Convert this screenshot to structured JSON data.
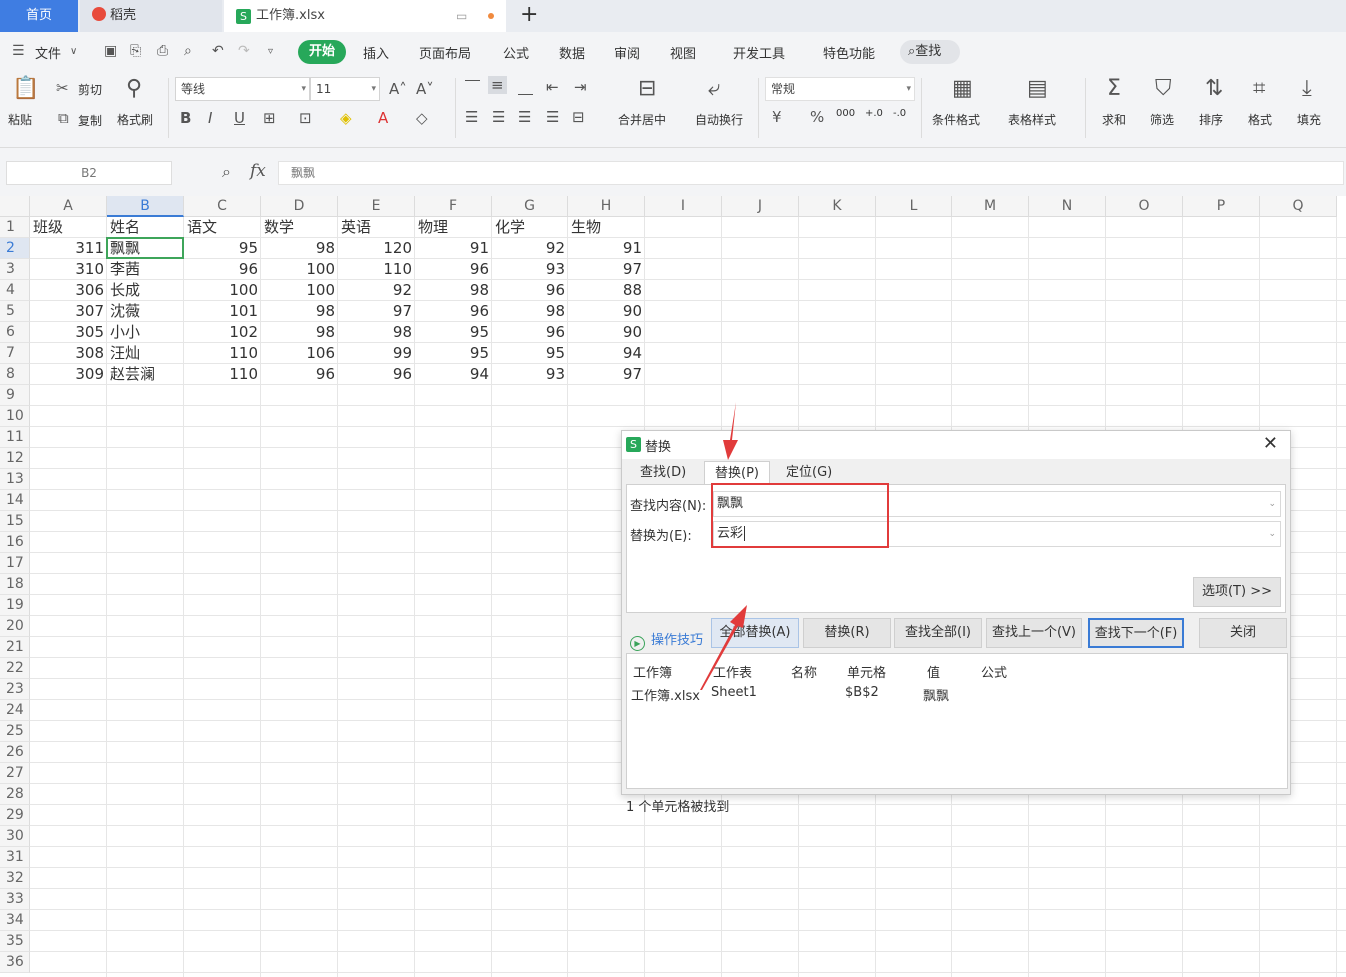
{
  "titlebar": {
    "home_tab": "首页",
    "app_tab": "稻壳",
    "file_tab": "工作簿.xlsx",
    "add_tab": "+"
  },
  "menubar": {
    "file_menu": "文件",
    "items": [
      "开始",
      "插入",
      "页面布局",
      "公式",
      "数据",
      "审阅",
      "视图",
      "开发工具",
      "特色功能"
    ],
    "search": "查找"
  },
  "ribbon": {
    "paste": "粘贴",
    "cut": "剪切",
    "copy": "复制",
    "format_painter": "格式刷",
    "font_name": "等线",
    "font_size": "11",
    "merge_center": "合并居中",
    "wrap_text": "自动换行",
    "number_format": "常规",
    "conditional_format": "条件格式",
    "table_style": "表格样式",
    "sum": "求和",
    "filter": "筛选",
    "sort": "排序",
    "format": "格式",
    "fill": "填充"
  },
  "formula_bar": {
    "name_box": "B2",
    "fx": "fx",
    "value": "飘飘"
  },
  "sheet": {
    "columns": [
      "A",
      "B",
      "C",
      "D",
      "E",
      "F",
      "G",
      "H",
      "I",
      "J",
      "K",
      "L",
      "M",
      "N",
      "O",
      "P",
      "Q"
    ],
    "rows": [
      "1",
      "2",
      "3",
      "4",
      "5",
      "6",
      "7",
      "8",
      "9",
      "10",
      "11",
      "12",
      "13",
      "14",
      "15",
      "16",
      "17",
      "18",
      "19",
      "20",
      "21",
      "22",
      "23",
      "24",
      "25",
      "26",
      "27",
      "28",
      "29",
      "30",
      "31",
      "32",
      "33",
      "34",
      "35",
      "36"
    ],
    "headers": [
      "班级",
      "姓名",
      "语文",
      "数学",
      "英语",
      "物理",
      "化学",
      "生物"
    ],
    "data": [
      [
        "311",
        "飘飘",
        "95",
        "98",
        "120",
        "91",
        "92",
        "91"
      ],
      [
        "310",
        "李茜",
        "96",
        "100",
        "110",
        "96",
        "93",
        "97"
      ],
      [
        "306",
        "长成",
        "100",
        "100",
        "92",
        "98",
        "96",
        "88"
      ],
      [
        "307",
        "沈薇",
        "101",
        "98",
        "97",
        "96",
        "98",
        "90"
      ],
      [
        "305",
        "小小",
        "102",
        "98",
        "98",
        "95",
        "96",
        "90"
      ],
      [
        "308",
        "汪灿",
        "110",
        "106",
        "99",
        "95",
        "95",
        "94"
      ],
      [
        "309",
        "赵芸澜",
        "110",
        "96",
        "96",
        "94",
        "93",
        "97"
      ]
    ]
  },
  "dialog": {
    "title": "替换",
    "tabs": [
      "查找(D)",
      "替换(P)",
      "定位(G)"
    ],
    "find_label": "查找内容(N):",
    "find_value": "飘飘",
    "replace_label": "替换为(E):",
    "replace_value": "云彩",
    "options_button": "选项(T) >>",
    "tips": "操作技巧",
    "buttons": {
      "replace_all": "全部替换(A)",
      "replace": "替换(R)",
      "find_all": "查找全部(I)",
      "find_prev": "查找上一个(V)",
      "find_next": "查找下一个(F)",
      "close": "关闭"
    },
    "result_headers": [
      "工作簿",
      "工作表",
      "名称",
      "单元格",
      "值",
      "公式"
    ],
    "result_row": [
      "工作簿.xlsx",
      "Sheet1",
      "",
      "$B$2",
      "飘飘",
      ""
    ],
    "status": "1 个单元格被找到"
  },
  "colors": {
    "accent_green": "#27a85a",
    "home_tab_blue": "#3f7de2",
    "annotation_red": "#e13b3b"
  }
}
